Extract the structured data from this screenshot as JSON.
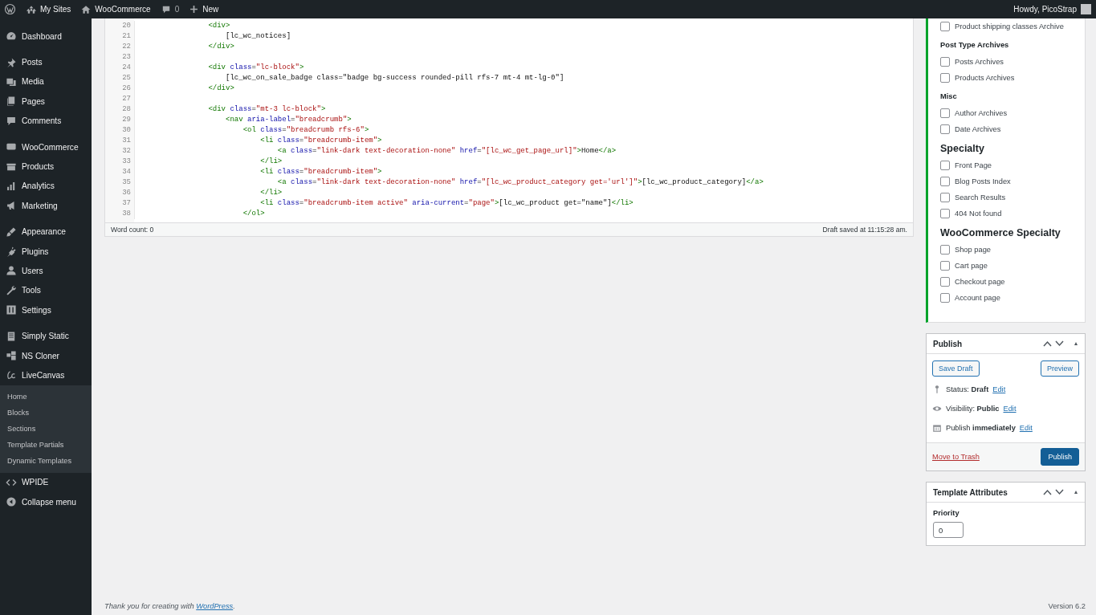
{
  "admin_bar": {
    "my_sites": "My Sites",
    "site": "WooCommerce",
    "comments_count": "0",
    "new": "New",
    "greeting": "Howdy, PicoStrap"
  },
  "sidebar": {
    "groups": [
      {
        "items": [
          {
            "label": "Dashboard"
          }
        ]
      },
      {
        "items": [
          {
            "label": "Posts"
          },
          {
            "label": "Media"
          },
          {
            "label": "Pages"
          },
          {
            "label": "Comments"
          }
        ]
      },
      {
        "items": [
          {
            "label": "WooCommerce"
          },
          {
            "label": "Products"
          },
          {
            "label": "Analytics"
          },
          {
            "label": "Marketing"
          }
        ]
      },
      {
        "items": [
          {
            "label": "Appearance"
          },
          {
            "label": "Plugins"
          },
          {
            "label": "Users"
          },
          {
            "label": "Tools"
          },
          {
            "label": "Settings"
          }
        ]
      },
      {
        "items": [
          {
            "label": "Simply Static"
          },
          {
            "label": "NS Cloner"
          },
          {
            "label": "LiveCanvas",
            "children": [
              {
                "label": "Home"
              },
              {
                "label": "Blocks"
              },
              {
                "label": "Sections"
              },
              {
                "label": "Template Partials"
              },
              {
                "label": "Dynamic Templates"
              }
            ]
          },
          {
            "label": "WPIDE"
          },
          {
            "label": "Collapse menu"
          }
        ]
      }
    ]
  },
  "editor": {
    "lines": [
      {
        "number": "20",
        "code": "                <div>"
      },
      {
        "number": "21",
        "code": "                    [lc_wc_notices]"
      },
      {
        "number": "22",
        "code": "                </div>"
      },
      {
        "number": "23"
      },
      {
        "number": "24",
        "code": "                <div class=\"lc-block\">"
      },
      {
        "number": "25",
        "code": "                    [lc_wc_on_sale_badge class=\"badge bg-success rounded-pill rfs-7 mt-4 mt-lg-0\"]"
      },
      {
        "number": "26",
        "code": "                </div>"
      },
      {
        "number": "27"
      },
      {
        "number": "28",
        "code": "                <div class=\"mt-3 lc-block\">"
      },
      {
        "number": "29",
        "code": "                    <nav aria-label=\"breadcrumb\">"
      },
      {
        "number": "30",
        "code": "                        <ol class=\"breadcrumb rfs-6\">"
      },
      {
        "number": "31",
        "code": "                            <li class=\"breadcrumb-item\">"
      },
      {
        "number": "32",
        "code": "                                <a class=\"link-dark text-decoration-none\" href=\"[lc_wc_get_page_url]\">Home</a>"
      },
      {
        "number": "33",
        "code": "                            </li>"
      },
      {
        "number": "34",
        "code": "                            <li class=\"breadcrumb-item\">"
      },
      {
        "number": "35",
        "code": "                                <a class=\"link-dark text-decoration-none\" href=\"[lc_wc_product_category get='url']\">[lc_wc_product_category]</a>"
      },
      {
        "number": "36",
        "code": "                            </li>"
      },
      {
        "number": "37",
        "code": "                            <li class=\"breadcrumb-item active\" aria-current=\"page\">[lc_wc_product get=\"name\"]</li>"
      },
      {
        "number": "38",
        "code": "                        </ol>"
      }
    ],
    "word_count": "Word count: 0",
    "saved": "Draft saved at 11:15:28 am."
  },
  "conditions": [
    {
      "kind": "plain",
      "items": [
        {
          "label": "Product shipping classes Archive",
          "checked": false
        }
      ]
    },
    {
      "kind": "subheading",
      "title": "Post Type Archives",
      "items": [
        {
          "label": "Posts Archives",
          "checked": false
        },
        {
          "label": "Products Archives",
          "checked": false
        }
      ]
    },
    {
      "kind": "subheading",
      "title": "Misc",
      "items": [
        {
          "label": "Author Archives",
          "checked": false
        },
        {
          "label": "Date Archives",
          "checked": false
        }
      ]
    },
    {
      "kind": "heading",
      "title": "Specialty",
      "items": [
        {
          "label": "Front Page",
          "checked": false
        },
        {
          "label": "Blog Posts Index",
          "checked": false
        },
        {
          "label": "Search Results",
          "checked": false
        },
        {
          "label": "404 Not found",
          "checked": false
        }
      ]
    },
    {
      "kind": "heading",
      "title": "WooCommerce Specialty",
      "items": [
        {
          "label": "Shop page",
          "checked": false
        },
        {
          "label": "Cart page",
          "checked": false
        },
        {
          "label": "Checkout page",
          "checked": false
        },
        {
          "label": "Account page",
          "checked": false
        }
      ]
    }
  ],
  "publish": {
    "title": "Publish",
    "save_draft": "Save Draft",
    "preview": "Preview",
    "rows": [
      {
        "text": "Status: **Draft**",
        "link": "Edit"
      },
      {
        "text": "Visibility: **Public**",
        "link": "Edit"
      },
      {
        "text": "Publish **immediately**",
        "link": "Edit"
      }
    ],
    "trash": "Move to Trash",
    "publish": "Publish"
  },
  "template_attributes": {
    "title": "Template Attributes",
    "label": "Priority",
    "value": "0"
  },
  "footer": {
    "text": "Thank you for creating with ",
    "link": "WordPress",
    "after": ".",
    "version": "Version 6.2"
  }
}
